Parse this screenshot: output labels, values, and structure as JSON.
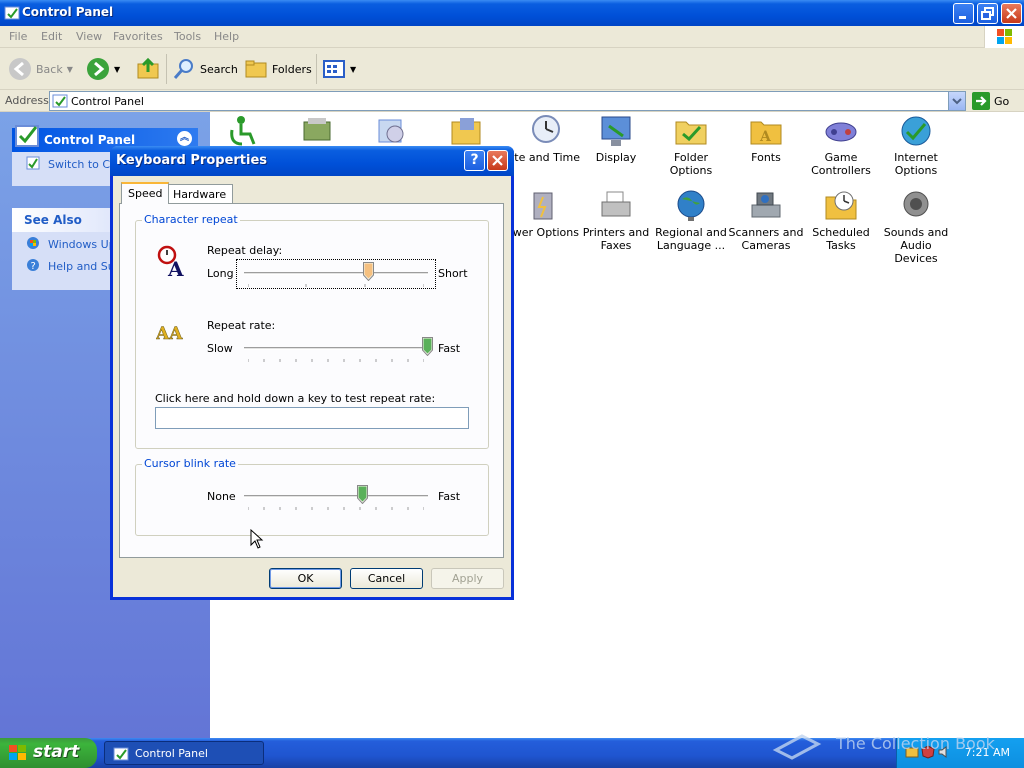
{
  "window": {
    "title": "Control Panel"
  },
  "menu": [
    "File",
    "Edit",
    "View",
    "Favorites",
    "Tools",
    "Help"
  ],
  "toolbar": {
    "back": "Back",
    "search": "Search",
    "folders": "Folders"
  },
  "address": {
    "label": "Address",
    "value": "Control Panel",
    "go": "Go"
  },
  "taskpane": {
    "panel_title": "Control Panel",
    "switch_link": "Switch to Category View",
    "see_also_title": "See Also",
    "see_also": [
      "Windows Update",
      "Help and Support"
    ]
  },
  "content_items": [
    {
      "label": "Date and Time",
      "color": "#9ab6e0"
    },
    {
      "label": "Display",
      "color": "#5c8fd8"
    },
    {
      "label": "Folder Options",
      "color": "#f0d060"
    },
    {
      "label": "Fonts",
      "color": "#f0c040"
    },
    {
      "label": "Game Controllers",
      "color": "#8080d8"
    },
    {
      "label": "Internet Options",
      "color": "#3aa0d8"
    },
    {
      "label": "Power Options",
      "color": "#b0b0c0"
    },
    {
      "label": "Printers and Faxes",
      "color": "#c0c0c0"
    },
    {
      "label": "Regional and Language ...",
      "color": "#3080c8"
    },
    {
      "label": "Scanners and Cameras",
      "color": "#a0a8b0"
    },
    {
      "label": "Scheduled Tasks",
      "color": "#f0c040"
    },
    {
      "label": "Sounds and Audio Devices",
      "color": "#909090"
    }
  ],
  "dialog": {
    "title": "Keyboard Properties",
    "tabs": [
      "Speed",
      "Hardware"
    ],
    "char_repeat_group": "Character repeat",
    "repeat_delay": {
      "label": "Repeat delay:",
      "min_label": "Long",
      "max_label": "Short",
      "level": 0.67
    },
    "repeat_rate": {
      "label": "Repeat rate:",
      "min_label": "Slow",
      "max_label": "Fast",
      "level": 1.0
    },
    "test_label": "Click here and hold down a key to test repeat rate:",
    "test_value": "",
    "cursor_group": "Cursor blink rate",
    "cursor_blink": {
      "min_label": "None",
      "max_label": "Fast",
      "level": 0.64
    },
    "buttons": {
      "ok": "OK",
      "cancel": "Cancel",
      "apply": "Apply"
    }
  },
  "taskbar": {
    "start": "start",
    "task": "Control Panel",
    "clock": "7:21 AM",
    "watermark": "The Collection Book"
  },
  "colors": {
    "xp_blue": "#0054e3",
    "accent_group": "#0046d5"
  }
}
